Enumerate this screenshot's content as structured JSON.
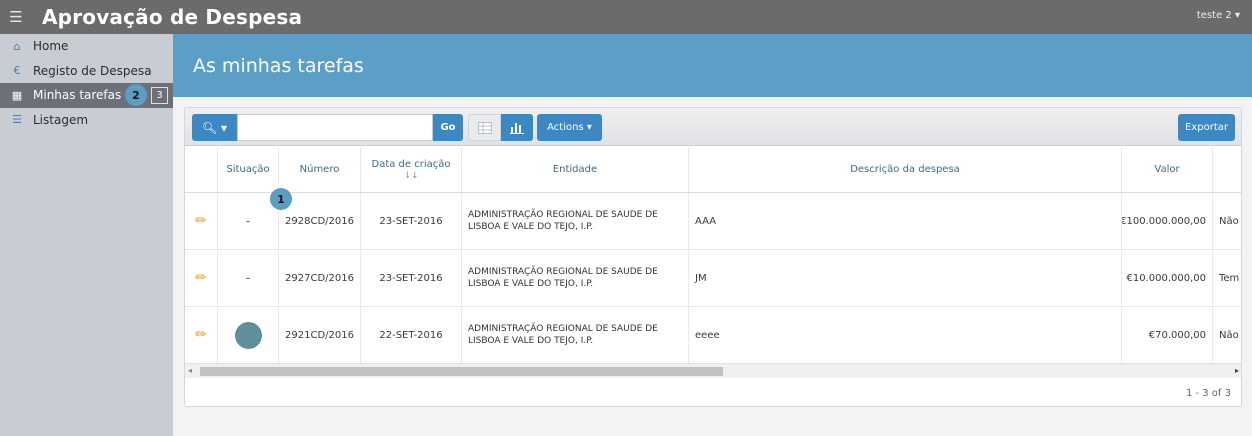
{
  "app": {
    "title": "Aprovação de Despesa",
    "menu_icon": "hamburger-icon",
    "user": "teste 2 ▾"
  },
  "sidebar": {
    "items": [
      {
        "label": "Home",
        "icon": "home-icon",
        "glyph": "⌂"
      },
      {
        "label": "Registo de Despesa",
        "icon": "euro-icon",
        "glyph": "€"
      },
      {
        "label": "Minhas tarefas",
        "icon": "calendar-icon",
        "glyph": "▦",
        "count": "3",
        "step": "2"
      },
      {
        "label": "Listagem",
        "icon": "list-icon",
        "glyph": "☰"
      }
    ]
  },
  "page": {
    "title": "As minhas tarefas"
  },
  "toolbar": {
    "search_glyph": "🔍︎ ▾",
    "search_value": "",
    "go_label": "Go",
    "actions_label": "Actions ▾",
    "export_label": "Exportar"
  },
  "table": {
    "headers": {
      "situacao": "Situação",
      "numero": "Número",
      "data": "Data de criação",
      "entidade": "Entidade",
      "descricao": "Descrição da despesa",
      "valor": "Valor"
    },
    "step_marker": "1",
    "rows": [
      {
        "situacao": "–",
        "numero": "2928CD/2016",
        "data": "23-SET-2016",
        "entidade": "ADMINISTRAÇÃO REGIONAL DE SAUDE DE LISBOA E VALE DO TEJO, I.P.",
        "descricao": "AAA",
        "valor": "€100.000.000,00",
        "extra": "Não"
      },
      {
        "situacao": "–",
        "numero": "2927CD/2016",
        "data": "23-SET-2016",
        "entidade": "ADMINISTRAÇÃO REGIONAL DE SAUDE DE LISBOA E VALE DO TEJO, I.P.",
        "descricao": "JM",
        "valor": "€10.000.000,00",
        "extra": "Tem"
      },
      {
        "situacao": "",
        "numero": "2921CD/2016",
        "data": "22-SET-2016",
        "entidade": "ADMINISTRAÇÃO REGIONAL DE SAUDE DE LISBOA E VALE DO TEJO, I.P.",
        "descricao": "eeee",
        "valor": "€70.000,00",
        "extra": "Não"
      }
    ]
  },
  "pagination": {
    "text": "1 - 3 of 3"
  },
  "colors": {
    "accent": "#3b88c3",
    "header_band": "#5b9fc6",
    "topbar": "#6b6b6b",
    "status_circle": "#5f8f99"
  }
}
